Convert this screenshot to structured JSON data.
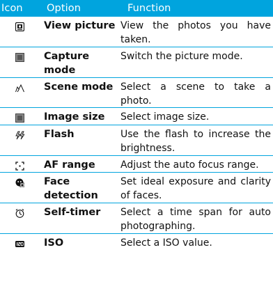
{
  "header": {
    "col_icon": "Icon",
    "col_option": "Option",
    "col_function": "Function"
  },
  "colors": {
    "accent": "#00a4de"
  },
  "rows": [
    {
      "icon": "view-picture-icon",
      "option": "View picture",
      "function": "View the photos you have taken."
    },
    {
      "icon": "capture-mode-icon",
      "option": "Capture mode",
      "function": "Switch the picture mode."
    },
    {
      "icon": "scene-mode-icon",
      "option": "Scene mode",
      "function": "Select a scene to take a photo."
    },
    {
      "icon": "image-size-icon",
      "option": "Image size",
      "function": "Select image size."
    },
    {
      "icon": "flash-icon",
      "option": "Flash",
      "function": "Use the flash to increase the brightness."
    },
    {
      "icon": "af-range-icon",
      "option": "AF range",
      "function": "Adjust the auto focus range."
    },
    {
      "icon": "face-detection-icon",
      "option": "Face detection",
      "function": "Set ideal exposure and clarity of faces."
    },
    {
      "icon": "self-timer-icon",
      "option": "Self-timer",
      "function": "Select a time span for auto photographing."
    },
    {
      "icon": "iso-icon",
      "option": "ISO",
      "function": "Select a ISO value."
    }
  ]
}
